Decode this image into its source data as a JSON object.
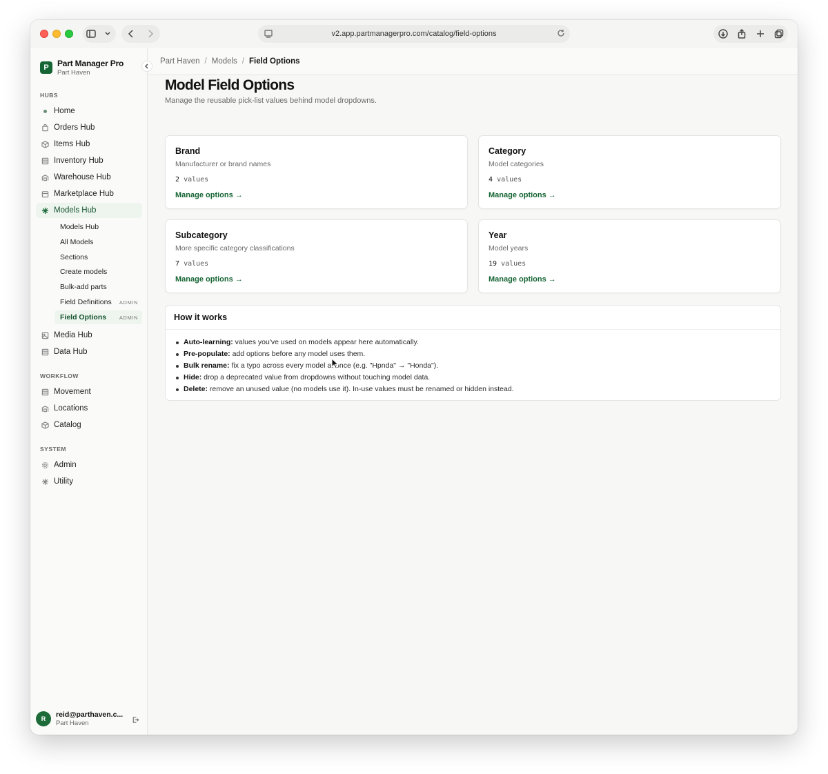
{
  "browser": {
    "url": "v2.app.partmanagerpro.com/catalog/field-options"
  },
  "app": {
    "name": "Part Manager Pro",
    "org": "Part Haven"
  },
  "sidebar": {
    "hubs_label": "HUBS",
    "hubs": [
      {
        "label": "Home",
        "icon": "dot-icon"
      },
      {
        "label": "Orders Hub",
        "icon": "bag-icon"
      },
      {
        "label": "Items Hub",
        "icon": "cube-icon"
      },
      {
        "label": "Inventory Hub",
        "icon": "list-icon"
      },
      {
        "label": "Warehouse Hub",
        "icon": "warehouse-icon"
      },
      {
        "label": "Marketplace Hub",
        "icon": "store-icon"
      },
      {
        "label": "Models Hub",
        "icon": "sparkle-icon"
      }
    ],
    "models_sub": [
      {
        "label": "Models Hub",
        "badge": ""
      },
      {
        "label": "All Models",
        "badge": ""
      },
      {
        "label": "Sections",
        "badge": ""
      },
      {
        "label": "Create models",
        "badge": ""
      },
      {
        "label": "Bulk-add parts",
        "badge": ""
      },
      {
        "label": "Field Definitions",
        "badge": "ADMIN"
      },
      {
        "label": "Field Options",
        "badge": "ADMIN"
      }
    ],
    "hubs_more": [
      {
        "label": "Media Hub",
        "icon": "image-icon"
      },
      {
        "label": "Data Hub",
        "icon": "list-icon"
      }
    ],
    "workflow_label": "WORKFLOW",
    "workflow": [
      {
        "label": "Movement",
        "icon": "list-icon"
      },
      {
        "label": "Locations",
        "icon": "warehouse-icon"
      },
      {
        "label": "Catalog",
        "icon": "cube-icon"
      }
    ],
    "system_label": "SYSTEM",
    "system": [
      {
        "label": "Admin",
        "icon": "gear-icon"
      },
      {
        "label": "Utility",
        "icon": "sparkle-icon"
      }
    ],
    "user": {
      "initial": "R",
      "email": "reid@parthaven.c...",
      "org": "Part Haven"
    }
  },
  "breadcrumb": {
    "items": [
      "Part Haven",
      "Models"
    ],
    "current": "Field Options",
    "sep": "/"
  },
  "page": {
    "title": "Model Field Options",
    "subtitle": "Manage the reusable pick-list values behind model dropdowns."
  },
  "cards": [
    {
      "title": "Brand",
      "desc": "Manufacturer or brand names",
      "count": "2",
      "unit": "values",
      "link": "Manage options →"
    },
    {
      "title": "Category",
      "desc": "Model categories",
      "count": "4",
      "unit": "values",
      "link": "Manage options →"
    },
    {
      "title": "Subcategory",
      "desc": "More specific category classifications",
      "count": "7",
      "unit": "values",
      "link": "Manage options →"
    },
    {
      "title": "Year",
      "desc": "Model years",
      "count": "19",
      "unit": "values",
      "link": "Manage options →"
    }
  ],
  "how": {
    "title": "How it works",
    "items": [
      {
        "term": "Auto-learning:",
        "text": " values you've used on models appear here automatically."
      },
      {
        "term": "Pre-populate:",
        "text": " add options before any model uses them."
      },
      {
        "term": "Bulk rename:",
        "text": " fix a typo across every model at once (e.g. \"Hpnda\" → \"Honda\")."
      },
      {
        "term": "Hide:",
        "text": " drop a deprecated value from dropdowns without touching model data."
      },
      {
        "term": "Delete:",
        "text": " remove an unused value (no models use it). In-use values must be renamed or hidden instead."
      }
    ]
  }
}
